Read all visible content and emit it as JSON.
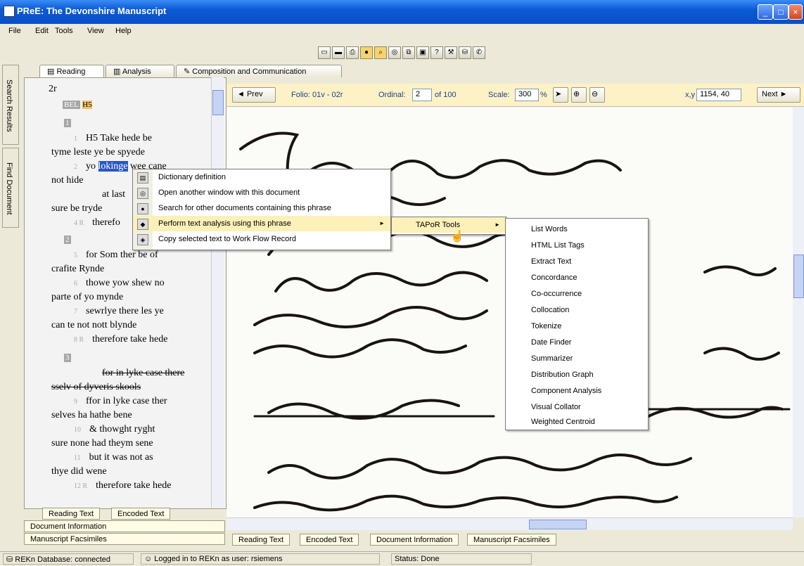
{
  "window": {
    "title": "PReE: The Devonshire Manuscript"
  },
  "menu": [
    "File",
    "Edit",
    "Tools",
    "View",
    "Help"
  ],
  "side_tabs": [
    "Search Results",
    "Find Document"
  ],
  "top_tabs": [
    "Reading",
    "Analysis",
    "Composition and Communication"
  ],
  "reading": {
    "folio": "2r",
    "tags": [
      "BEL",
      "H5"
    ],
    "stanza_markers": [
      "1",
      "2",
      "3"
    ],
    "lines": [
      {
        "n": "1",
        "text": "H5 Take hede be"
      },
      {
        "n": "",
        "text": "tyme leste ye be spyede"
      },
      {
        "n": "2",
        "text": "yo"
      },
      {
        "n": "",
        "text": "not hide"
      },
      {
        "n": "",
        "text": "at last"
      },
      {
        "n": "",
        "text": "sure be tryde"
      },
      {
        "n": "4 R",
        "text": "therefo"
      },
      {
        "n": "5",
        "text": "for Som ther be of"
      },
      {
        "n": "",
        "text": "crafite Rynde"
      },
      {
        "n": "6",
        "text": "thowe yow shew no"
      },
      {
        "n": "",
        "text": "parte of yo mynde"
      },
      {
        "n": "7",
        "text": "sewrlye there les ye"
      },
      {
        "n": "",
        "text": "can te not nott blynde"
      },
      {
        "n": "8 R",
        "text": "therefore take hede"
      },
      {
        "n": "",
        "text": "for in lyke case there"
      },
      {
        "n": "",
        "text": "sselv of dyveris skools"
      },
      {
        "n": "9",
        "text": "ffor in lyke case ther"
      },
      {
        "n": "",
        "text": "selves ha hathe bene"
      },
      {
        "n": "10",
        "text": "& thowght ryght"
      },
      {
        "n": "",
        "text": "sure none had theym sene"
      },
      {
        "n": "11",
        "text": "but it was not as"
      },
      {
        "n": "",
        "text": "thye did wene"
      },
      {
        "n": "12 R",
        "text": "therefore take hede"
      }
    ],
    "selected_word": "lokinge",
    "partial_text": "wee cane"
  },
  "left_bottom_tabs": [
    "Reading Text",
    "Encoded Text",
    "Document Information",
    "Manuscript Facsimiles"
  ],
  "facsimile_toolbar": {
    "prev": "Prev",
    "folio": "Folio: 01v - 02r",
    "ordinal_label": "Ordinal:",
    "ordinal": "2",
    "of": "of 100",
    "scale_label": "Scale:",
    "scale": "300",
    "percent": "%",
    "xy_label": "x,y",
    "xy": "1154, 40",
    "next": "Next"
  },
  "right_bottom_tabs": [
    "Reading Text",
    "Encoded Text",
    "Document Information",
    "Manuscript Facsimiles"
  ],
  "context_menu": [
    {
      "icon": "dictionary-icon",
      "label": "Dictionary definition"
    },
    {
      "icon": "window-icon",
      "label": "Open another window with this document"
    },
    {
      "icon": "binoculars-icon",
      "label": "Search for other documents containing this phrase"
    },
    {
      "icon": "analysis-icon",
      "label": "Perform text analysis using this phrase"
    },
    {
      "icon": "copy-icon",
      "label": "Copy selected text to Work Flow Record"
    }
  ],
  "submenu1": {
    "label": "TAPoR Tools"
  },
  "submenu2": [
    "List Words",
    "HTML List Tags",
    "Extract Text",
    "Concordance",
    "Co-occurrence",
    "Collocation",
    "Tokenize",
    "Date Finder",
    "Summarizer",
    "Distribution Graph",
    "Component Analysis",
    "Visual Collator",
    "Weighted Centroid"
  ],
  "status": {
    "db": "REKn Database: connected",
    "login": "Logged in to REKn as user: rsiemens",
    "state": "Status: Done"
  }
}
